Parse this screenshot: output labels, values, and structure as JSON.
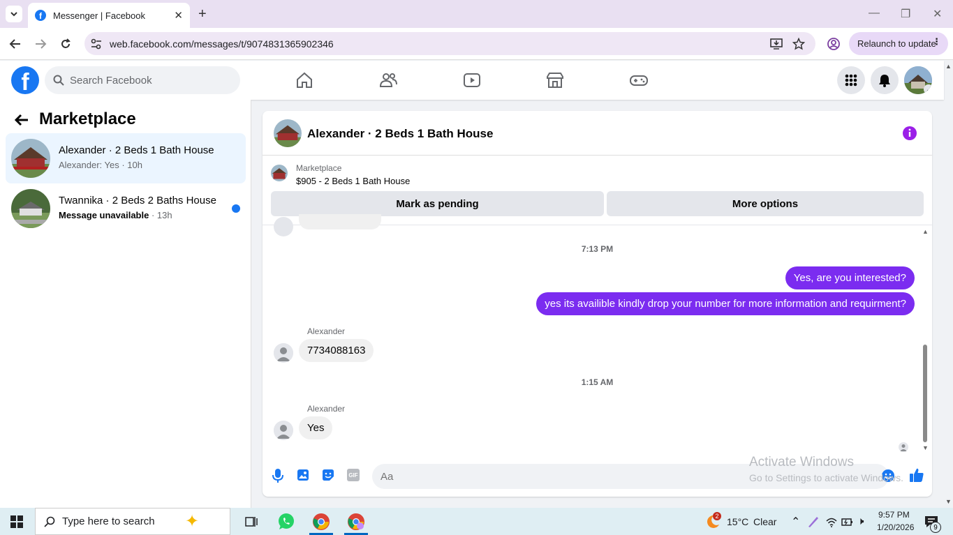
{
  "browser": {
    "tab_title": "Messenger | Facebook",
    "url": "web.facebook.com/messages/t/9074831365902346",
    "relaunch_label": "Relaunch to update"
  },
  "header": {
    "search_placeholder": "Search Facebook",
    "notification_count": ""
  },
  "sidebar": {
    "title": "Marketplace",
    "conversations": [
      {
        "name": "Alexander · 2 Beds 1 Bath House",
        "preview": "Alexander: Yes",
        "time": "10h",
        "selected": true,
        "unread": false
      },
      {
        "name": "Twannika · 2 Beds 2 Baths House",
        "preview": "Message unavailable",
        "time": "13h",
        "selected": false,
        "unread": true
      }
    ]
  },
  "chat": {
    "title": "Alexander · 2 Beds 1 Bath House",
    "listing_source": "Marketplace",
    "listing_title": "$905 - 2 Beds 1 Bath House",
    "mark_pending_label": "Mark as pending",
    "more_options_label": "More options",
    "timestamp_1": "7:13 PM",
    "outgoing_1": "Yes, are you interested?",
    "outgoing_2": "yes its availible kindly drop your number for more information and requirment?",
    "sender_1": "Alexander",
    "incoming_1": "7734088163",
    "timestamp_2": "1:15 AM",
    "sender_2": "Alexander",
    "incoming_2": "Yes",
    "composer_placeholder": "Aa"
  },
  "watermark": {
    "line1": "Activate Windows",
    "line2": "Go to Settings to activate Windows."
  },
  "taskbar": {
    "search_placeholder": "Type here to search",
    "weather_temp": "15°C",
    "weather_desc": "Clear",
    "weather_badge": "2",
    "time": "9:57 PM",
    "date": "1/20/2026",
    "notif_count": "9"
  },
  "colors": {
    "fb_blue": "#1877f2",
    "messenger_purple": "#7b2cf0",
    "selected_bg": "#ebf5ff"
  }
}
